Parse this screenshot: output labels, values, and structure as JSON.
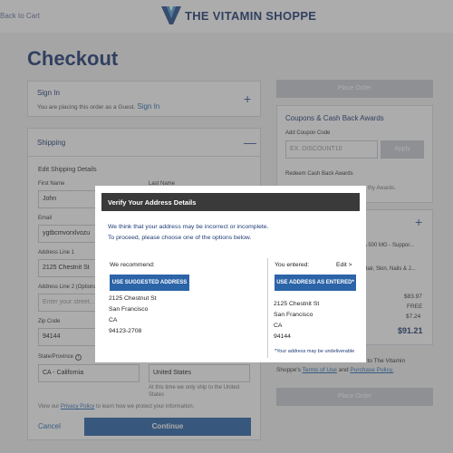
{
  "header": {
    "back_label": "Back to Cart",
    "logo_text": "THE VITAMIN SHOPPE"
  },
  "page_title": "Checkout",
  "signin": {
    "title": "Sign In",
    "guest_text": "You are placing this order as a Guest.",
    "signin_link": "Sign In"
  },
  "shipping": {
    "title": "Shipping",
    "edit_title": "Edit Shipping Details",
    "first_name_label": "First Name",
    "first_name_value": "John",
    "last_name_label": "Last Name",
    "email_label": "Email",
    "email_value": "ygtbcmvorxlvozu",
    "address1_label": "Address Line 1",
    "address1_value": "2125 Chestnit St",
    "address2_label": "Address Line 2 (Optional)",
    "address2_placeholder": "Enter your street...",
    "zip_label": "Zip Code",
    "zip_value": "94144",
    "state_label": "State/Province",
    "state_value": "CA - California",
    "country_value": "United States",
    "country_note": "At this time we only ship to the United States",
    "privacy_prefix": "View our",
    "privacy_link": "Privacy Policy",
    "privacy_suffix": "to learn how we protect your information.",
    "cancel_label": "Cancel",
    "continue_label": "Continue"
  },
  "sidebar": {
    "place_order_label": "Place Order",
    "coupons_title": "Coupons & Cash Back Awards",
    "add_coupon_label": "Add Coupon Code",
    "coupon_placeholder": "EX. DISCOUNT10",
    "apply_label": "Apply",
    "redeem_label": "Redeem Cash Back Awards",
    "awards_text": "thy Awards.",
    "item1_text": "A 500 MG - Suppor...",
    "item2_text": "Hair, Skin, Nails & J...",
    "price_subtotal": "$83.97",
    "price_shipping": "FREE",
    "price_tax": "$7.24",
    "price_total": "$91.21",
    "terms_prefix": "e to The Vitamin",
    "terms_line2_prefix": "Shoppe's",
    "terms_link": "Terms of Use",
    "terms_and": "and",
    "purchase_policy_link": "Purchase Policy."
  },
  "modal": {
    "title": "Verify Your Address Details",
    "msg_line1": "We think that your address may be incorrect or incomplete.",
    "msg_line2": "To proceed, please choose one of the options below.",
    "recommend_heading": "We recommend:",
    "use_suggested_label": "USE SUGGESTED ADDRESS",
    "suggested": [
      "2125 Chestnut St",
      "San Francisco",
      "CA",
      "94123-2708"
    ],
    "entered_heading": "You entered:",
    "edit_label": "Edit >",
    "use_entered_label": "USE ADDRESS AS ENTERED*",
    "entered": [
      "2125 Chestnit St",
      "San Francisco",
      "CA",
      "94144"
    ],
    "undeliverable_note": "*Your address may be undeliverable"
  },
  "colors": {
    "brand": "#1f3b74",
    "button_blue": "#2c64a8",
    "modal_header": "#3a3a3a"
  }
}
